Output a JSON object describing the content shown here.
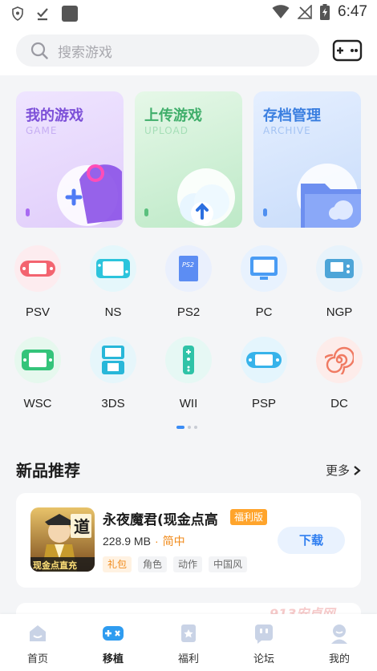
{
  "status_bar": {
    "time": "6:47"
  },
  "search": {
    "placeholder": "搜索游戏"
  },
  "cards": [
    {
      "title": "我的游戏",
      "subtitle": "GAME",
      "accent": "#8a5ad8"
    },
    {
      "title": "上传游戏",
      "subtitle": "UPLOAD",
      "accent": "#46b873"
    },
    {
      "title": "存档管理",
      "subtitle": "ARCHIVE",
      "accent": "#3b7fe0"
    }
  ],
  "platforms": [
    "PSV",
    "NS",
    "PS2",
    "PC",
    "NGP",
    "WSC",
    "3DS",
    "WII",
    "PSP",
    "DC"
  ],
  "ps2_icon_text": "PS2",
  "section": {
    "title": "新品推荐",
    "more": "更多"
  },
  "game": {
    "name": "永夜魔君(现金点高",
    "badge": "福利版",
    "size": "228.9 MB",
    "separator": "·",
    "language": "简中",
    "tags": [
      "礼包",
      "角色",
      "动作",
      "中国风"
    ],
    "download": "下载",
    "icon_text_top": "道",
    "icon_text_bottom": "现金点直充"
  },
  "watermark": "913安卓网",
  "tabs": [
    "首页",
    "移植",
    "福利",
    "论坛",
    "我的"
  ],
  "active_tab": "移植",
  "pager": {
    "pages": 3,
    "current": 1
  },
  "colors": {
    "accent_blue": "#3a8cf5",
    "orange": "#ffa42b"
  }
}
